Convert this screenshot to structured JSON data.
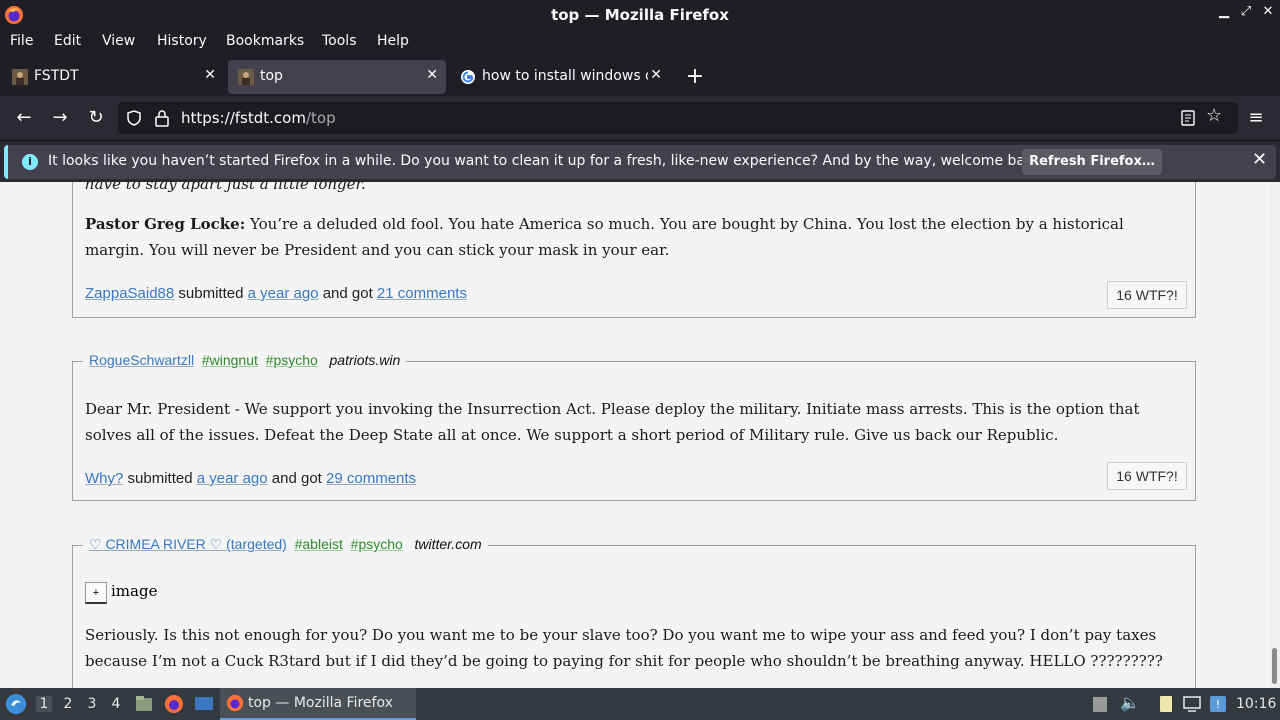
{
  "window": {
    "title": "top — Mozilla Firefox"
  },
  "menu": [
    "File",
    "Edit",
    "View",
    "History",
    "Bookmarks",
    "Tools",
    "Help"
  ],
  "tabs": [
    {
      "label": "FSTDT",
      "active": false
    },
    {
      "label": "top",
      "active": true
    },
    {
      "label": "how to install windows or",
      "active": false
    }
  ],
  "url": {
    "host": "https://fstdt.com",
    "path": "/top"
  },
  "notification": {
    "message": "It looks like you haven’t started Firefox in a while. Do you want to clean it up for a fresh, like-new experience? And by the way, welcome back!",
    "button": "Refresh Firefox…"
  },
  "posts": [
    {
      "partial_line": "have to stay apart just a little longer.",
      "speaker": "Pastor Greg Locke:",
      "quote": " You’re a deluded old fool. You hate America so much. You are bought by China. You lost the election by a historical margin. You will never be President and you can stick your mask in your ear.",
      "author": "ZappaSaid88",
      "submitted": "submitted",
      "time": "a year ago",
      "and_got": "and got",
      "comments": "21 comments",
      "wtf": "16 WTF?!"
    },
    {
      "author_tag": "RogueSchwartzll",
      "tags": [
        "#wingnut",
        "#psycho"
      ],
      "domain": "patriots.win",
      "quote": "Dear Mr. President - We support you invoking the Insurrection Act. Please deploy the military. Initiate mass arrests. This is the option that solves all of the issues. Defeat the Deep State all at once. We support a short period of Military rule. Give us back our Republic.",
      "author": "Why?",
      "submitted": "submitted",
      "time": "a year ago",
      "and_got": "and got",
      "comments": "29 comments",
      "wtf": "16 WTF?!"
    },
    {
      "author_tag": "♡ CRIMEA RIVER ♡ (targeted)",
      "tags": [
        "#ableist",
        "#psycho"
      ],
      "domain": "twitter.com",
      "expand": "+",
      "image_label": "image",
      "quote": "Seriously. Is this not enough for you? Do you want me to be your slave too? Do you want me to wipe your ass and feed you? I don’t pay taxes because I’m not a Cuck R3tard but if I did they’d be going to paying for shit for people who shouldn’t be breathing anyway. HELLO ?????????"
    }
  ],
  "taskbar": {
    "workspaces": [
      "1",
      "2",
      "3",
      "4"
    ],
    "task": "top — Mozilla Firefox",
    "clock": "10:16"
  },
  "icons": [
    "firefox-logo-icon",
    "back-icon",
    "forward-icon",
    "reload-icon",
    "shield-icon",
    "lock-icon",
    "reader-icon",
    "star-icon",
    "menu-icon",
    "info-icon",
    "close-icon"
  ]
}
